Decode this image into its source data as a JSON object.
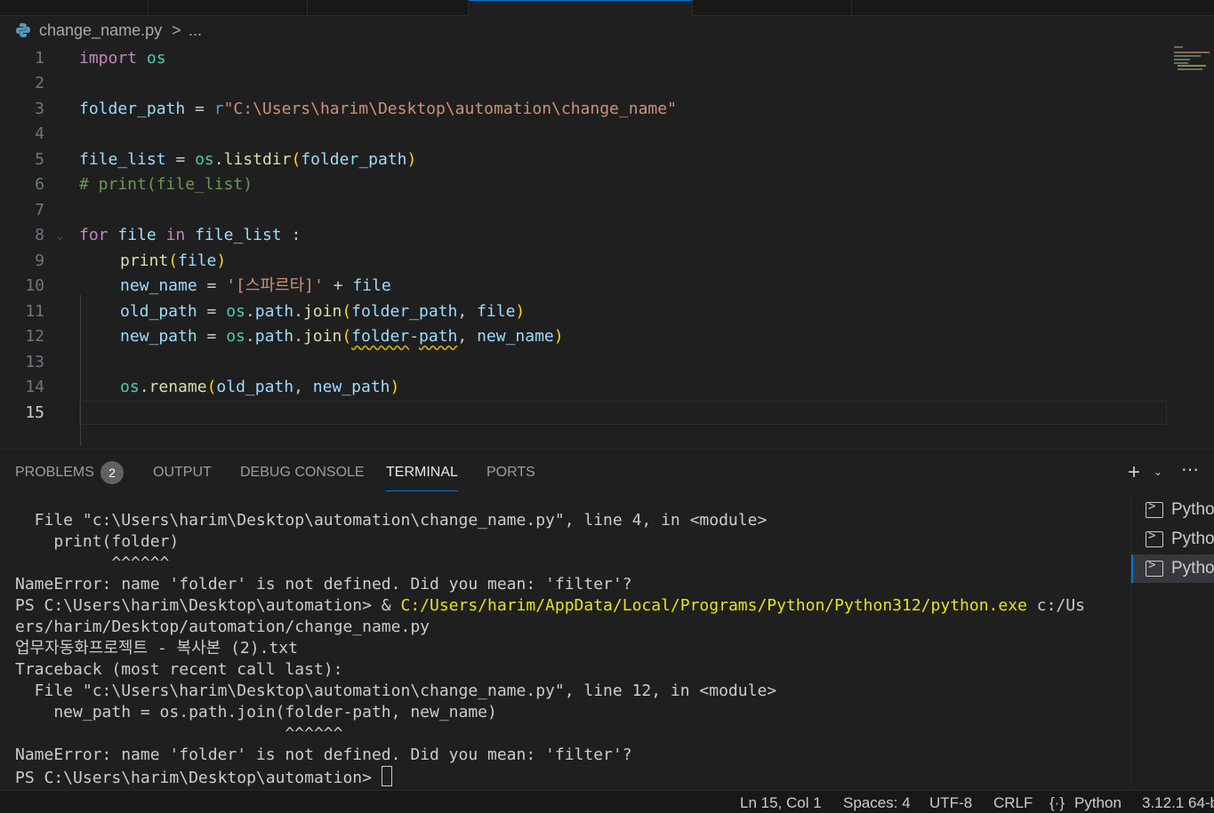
{
  "breadcrumb": {
    "file": "change_name.py",
    "separator": ">",
    "more": "..."
  },
  "editor": {
    "lines": [
      {
        "n": "1"
      },
      {
        "n": "2"
      },
      {
        "n": "3"
      },
      {
        "n": "4"
      },
      {
        "n": "5"
      },
      {
        "n": "6"
      },
      {
        "n": "7"
      },
      {
        "n": "8"
      },
      {
        "n": "9"
      },
      {
        "n": "10"
      },
      {
        "n": "11"
      },
      {
        "n": "12"
      },
      {
        "n": "13"
      },
      {
        "n": "14"
      },
      {
        "n": "15"
      }
    ],
    "tokens": {
      "import": "import",
      "os": "os",
      "folder_path": "folder_path",
      "eq": " = ",
      "r": "r",
      "path_str": "\"C:\\Users\\harim\\Desktop\\automation\\change_name\"",
      "file_list": "file_list",
      "dot": ".",
      "listdir": "listdir",
      "lp": "(",
      "rp": ")",
      "comment": "# print(file_list)",
      "for": "for",
      "file": "file",
      "in": "in",
      "colon": " :",
      "print": "print",
      "new_name": "new_name",
      "korean_str": "'[스파르타]'",
      "plus": " + ",
      "old_path": "old_path",
      "path": "path",
      "join": "join",
      "comma": ", ",
      "new_path": "new_path",
      "folder_dash": "folder",
      "dash": "-",
      "path_word": "path",
      "rename": "rename"
    }
  },
  "panel": {
    "tabs": [
      {
        "label": "PROBLEMS"
      },
      {
        "label": "OUTPUT"
      },
      {
        "label": "DEBUG CONSOLE"
      },
      {
        "label": "TERMINAL"
      },
      {
        "label": "PORTS"
      }
    ],
    "problems_count": "2",
    "add_icon": "plus-icon",
    "chevron_icon": "chevron-down-icon",
    "more_icon": "ellipsis-icon"
  },
  "terminal": {
    "lines": [
      "  File \"c:\\Users\\harim\\Desktop\\automation\\change_name.py\", line 4, in <module>",
      "    print(folder)",
      "          ^^^^^^",
      "NameError: name 'folder' is not defined. Did you mean: 'filter'?",
      "PS C:\\Users\\harim\\Desktop\\automation> & ",
      "C:/Users/harim/AppData/Local/Programs/Python/Python312/python.exe",
      " c:/Us",
      "ers/harim/Desktop/automation/change_name.py",
      "업무자동화프로젝트 - 복사본 (2).txt",
      "Traceback (most recent call last):",
      "  File \"c:\\Users\\harim\\Desktop\\automation\\change_name.py\", line 12, in <module>",
      "    new_path = os.path.join(folder-path, new_name)",
      "                            ^^^^^^",
      "NameError: name 'folder' is not defined. Did you mean: 'filter'?",
      "PS C:\\Users\\harim\\Desktop\\automation> "
    ],
    "instances": [
      "Pytho",
      "Pytho",
      "Pytho"
    ]
  },
  "statusbar": {
    "position": "Ln 15, Col 1",
    "spaces": "Spaces: 4",
    "encoding": "UTF-8",
    "eol": "CRLF",
    "language": "Python",
    "interpreter": "3.12.1 64-b"
  }
}
